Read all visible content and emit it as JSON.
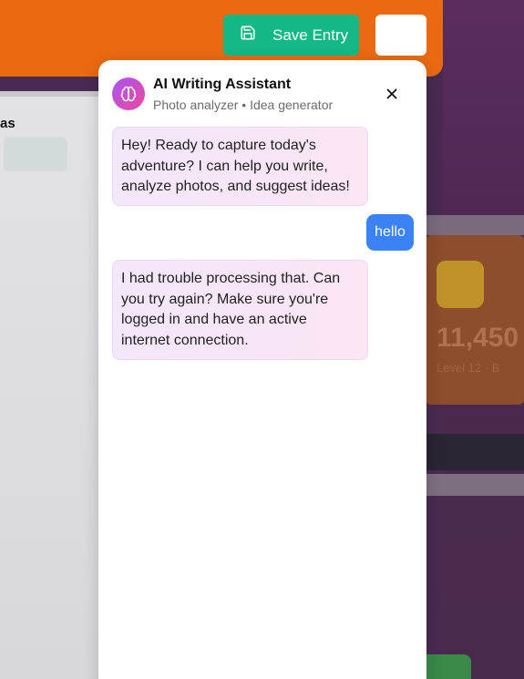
{
  "toolbar": {
    "save_label": "Save Entry"
  },
  "background": {
    "left_text": "as",
    "card_number": "11,450",
    "card_sub": "Level 12 · B"
  },
  "assistant": {
    "title": "AI Writing Assistant",
    "subtitle": "Photo analyzer • Idea generator",
    "messages": [
      {
        "role": "assistant",
        "text": "Hey! Ready to capture today's adventure? I can help you write, analyze photos, and suggest ideas!"
      },
      {
        "role": "user",
        "text": "hello"
      },
      {
        "role": "assistant",
        "text": "I had trouble processing that. Can you try again? Make sure you're logged in and have an active internet connection."
      }
    ]
  },
  "colors": {
    "header": "#ea6a12",
    "save_button": "#12b886",
    "user_bubble": "#3b82f6",
    "avatar_gradient": [
      "#a855f7",
      "#ec4899"
    ]
  },
  "icons": {
    "save": "floppy-disk-icon",
    "avatar": "brain-icon",
    "close": "close-icon"
  }
}
